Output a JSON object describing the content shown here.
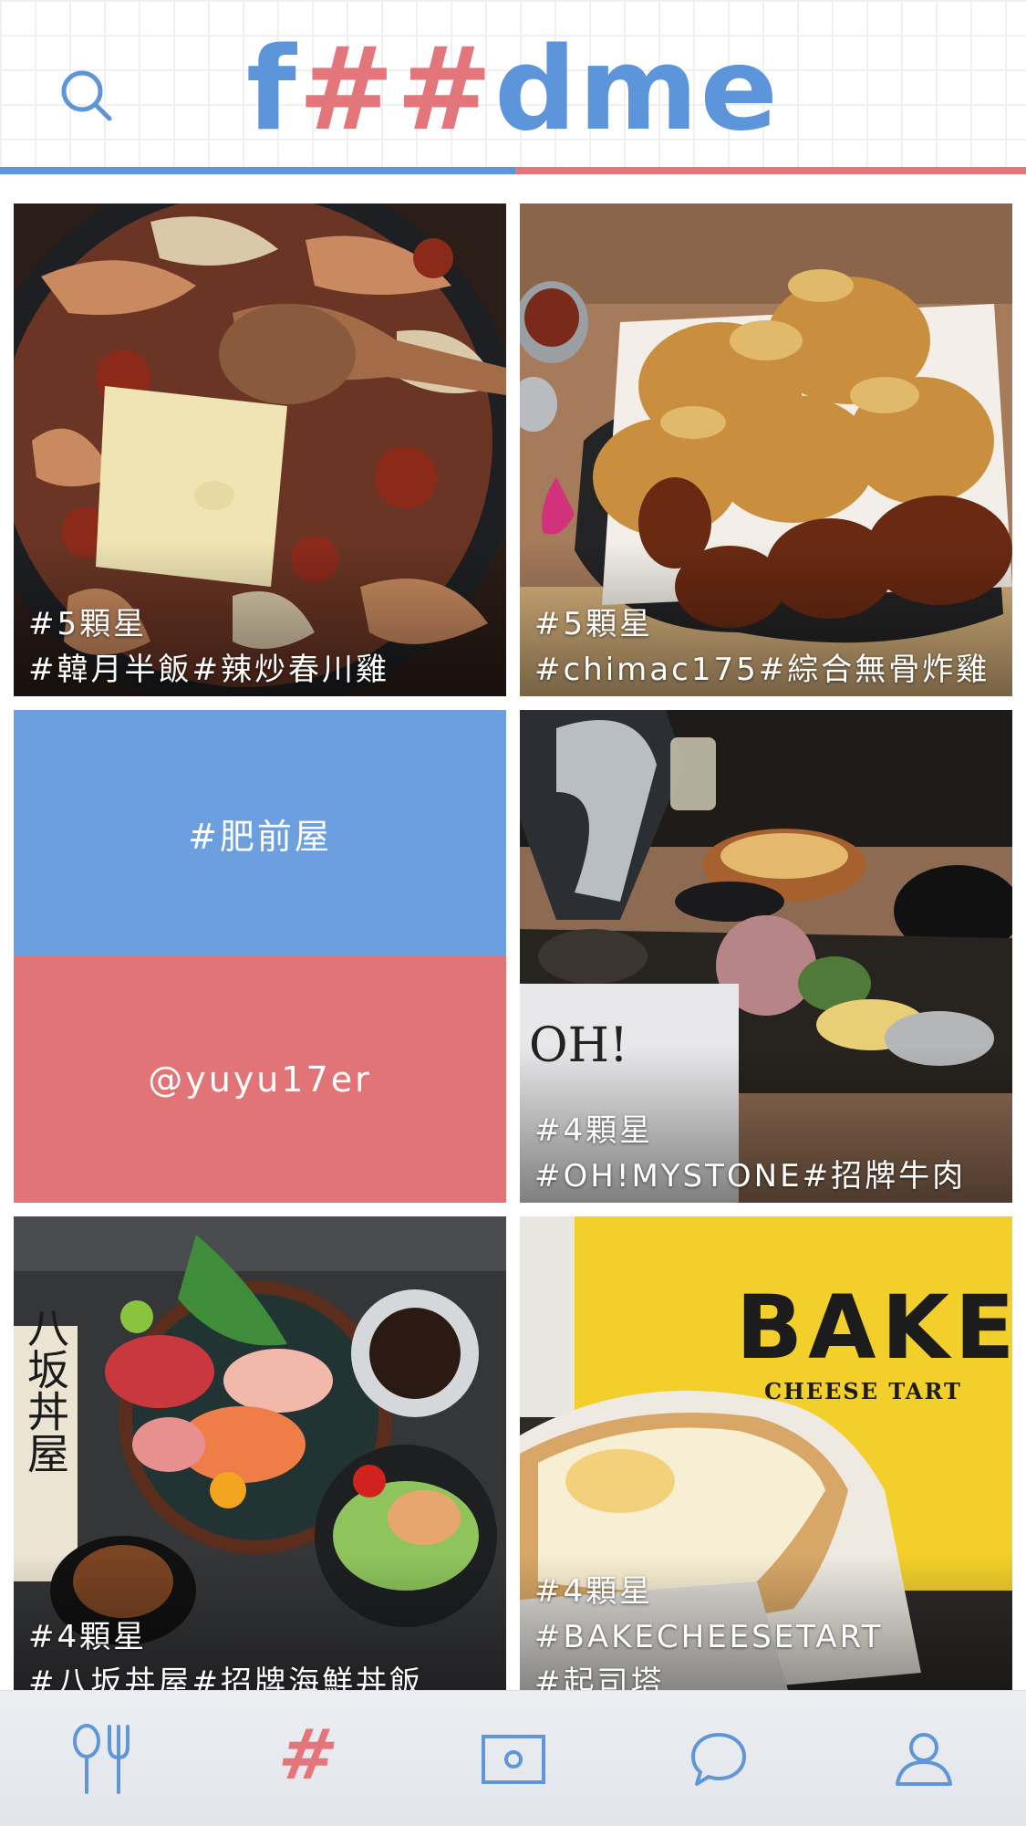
{
  "colors": {
    "blue": "#5c95da",
    "red": "#e2767a",
    "tile_blue": "#6b9fe0",
    "tile_red": "#e07476",
    "icon_blue": "#5f97d6"
  },
  "header": {
    "logo_parts": [
      "f",
      "##",
      "dme"
    ],
    "search_icon": "search-icon"
  },
  "posts": [
    {
      "rating": "#5顆星",
      "tags": "#韓月半飯#辣炒春川雞",
      "photo": "stir-fried spicy chicken with cheese"
    },
    {
      "rating": "#5顆星",
      "tags": "#chimac175#綜合無骨炸雞",
      "photo": "boneless fried chicken platter"
    },
    {
      "title": "#肥前屋",
      "user": "@yuyu17er"
    },
    {
      "rating": "#4顆星",
      "tags": "#OH!MYSTONE#招牌牛肉",
      "photo": "hot stone beef plate"
    },
    {
      "rating": "#4顆星",
      "tags": "#八坂丼屋#招牌海鮮丼飯",
      "photo": "seafood donburi set",
      "sign_text": "八坂丼屋"
    },
    {
      "rating": "#4顆星",
      "tags": "#BAKECHEESETART",
      "tags2": "#起司塔",
      "photo": "cheese tart",
      "bag_text": "BAKE",
      "bag_sub": "CHEESE TART"
    }
  ],
  "tabbar": {
    "items": [
      {
        "name": "food",
        "icon": "fork-spoon-icon"
      },
      {
        "name": "hashtag",
        "icon": "hashtag-icon",
        "label": "#",
        "active": true
      },
      {
        "name": "camera",
        "icon": "photo-icon"
      },
      {
        "name": "chat",
        "icon": "chat-bubble-icon"
      },
      {
        "name": "profile",
        "icon": "user-icon"
      }
    ]
  }
}
